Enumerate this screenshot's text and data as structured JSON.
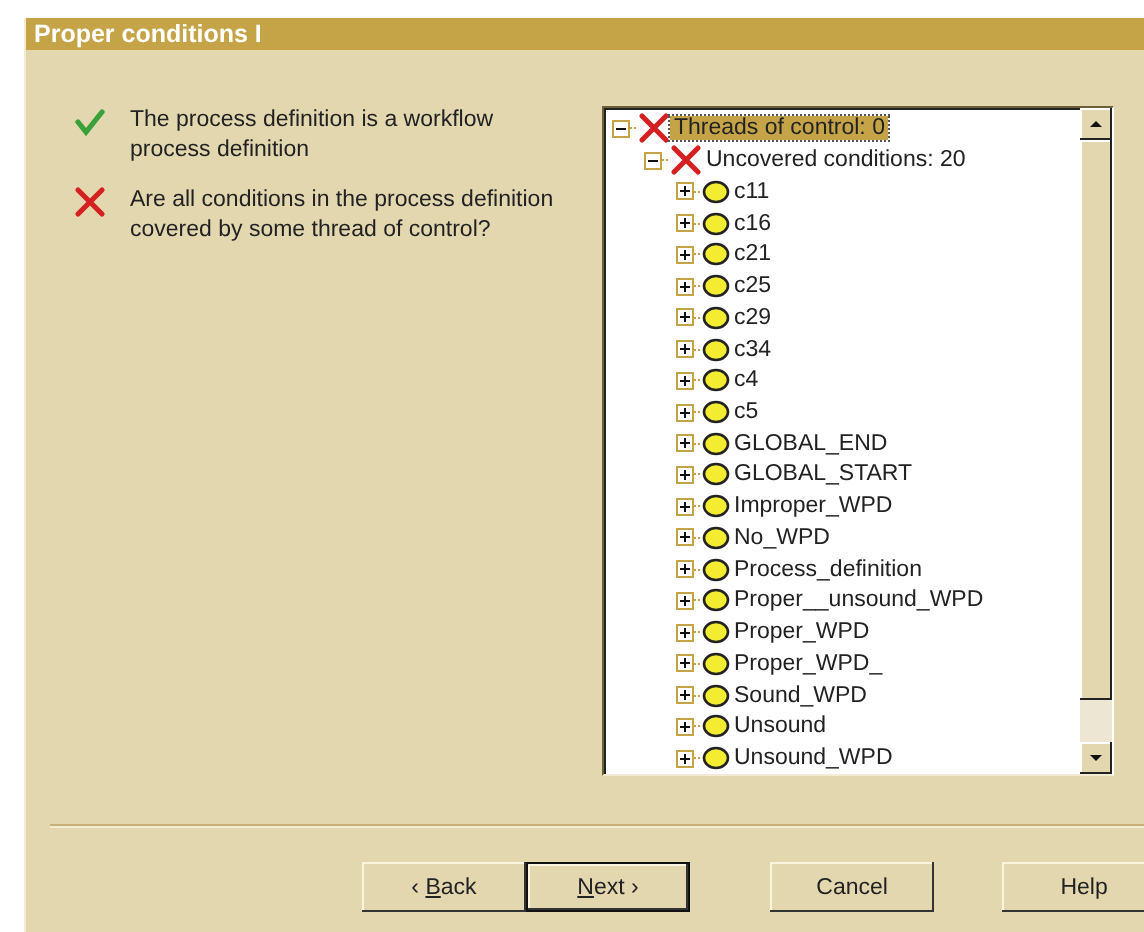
{
  "window": {
    "title": "Proper conditions I"
  },
  "checks": [
    {
      "kind": "passed",
      "text": "The process definition is a workflow process definition"
    },
    {
      "kind": "failed",
      "text": "Are all conditions in the process definition covered by some thread of control?"
    }
  ],
  "tree": [
    {
      "label": "Threads of control: 0",
      "kind": "failed",
      "expanded": true,
      "selected": true,
      "children": [
        {
          "label": "Uncovered conditions: 20",
          "kind": "failed",
          "expanded": true,
          "selected": false,
          "children": [
            {
              "label": "c11",
              "kind": "condition",
              "expanded": false,
              "selected": false
            },
            {
              "label": "c16",
              "kind": "condition",
              "expanded": false,
              "selected": false
            },
            {
              "label": "c21",
              "kind": "condition",
              "expanded": false,
              "selected": false
            },
            {
              "label": "c25",
              "kind": "condition",
              "expanded": false,
              "selected": false
            },
            {
              "label": "c29",
              "kind": "condition",
              "expanded": false,
              "selected": false
            },
            {
              "label": "c34",
              "kind": "condition",
              "expanded": false,
              "selected": false
            },
            {
              "label": "c4",
              "kind": "condition",
              "expanded": false,
              "selected": false
            },
            {
              "label": "c5",
              "kind": "condition",
              "expanded": false,
              "selected": false
            },
            {
              "label": "GLOBAL_END",
              "kind": "condition",
              "expanded": false,
              "selected": false
            },
            {
              "label": "GLOBAL_START",
              "kind": "condition",
              "expanded": false,
              "selected": false
            },
            {
              "label": "Improper_WPD",
              "kind": "condition",
              "expanded": false,
              "selected": false
            },
            {
              "label": "No_WPD",
              "kind": "condition",
              "expanded": false,
              "selected": false
            },
            {
              "label": "Process_definition",
              "kind": "condition",
              "expanded": false,
              "selected": false
            },
            {
              "label": "Proper__unsound_WPD",
              "kind": "condition",
              "expanded": false,
              "selected": false
            },
            {
              "label": "Proper_WPD",
              "kind": "condition",
              "expanded": false,
              "selected": false
            },
            {
              "label": "Proper_WPD_",
              "kind": "condition",
              "expanded": false,
              "selected": false
            },
            {
              "label": "Sound_WPD",
              "kind": "condition",
              "expanded": false,
              "selected": false
            },
            {
              "label": "Unsound",
              "kind": "condition",
              "expanded": false,
              "selected": false
            },
            {
              "label": "Unsound_WPD",
              "kind": "condition",
              "expanded": false,
              "selected": false
            }
          ]
        }
      ]
    }
  ],
  "buttons": [
    {
      "label": "Back",
      "arrow_before": "‹",
      "default": false
    },
    {
      "label": "Next",
      "arrow_after": "›",
      "default": true
    },
    {
      "label": "Cancel",
      "default": false
    },
    {
      "label": "Help",
      "default": false
    }
  ]
}
